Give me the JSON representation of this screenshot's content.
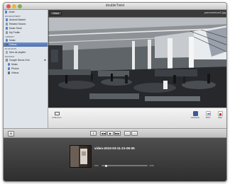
{
  "window": {
    "title": "doubleTwist"
  },
  "sidebar": {
    "user": "Jorah",
    "sections": [
      {
        "header": "DOUBLETWIST",
        "items": [
          "Android Market",
          "Related Search",
          "Music Store",
          "My Profile"
        ]
      },
      {
        "header": "LIBRARY",
        "items": [
          "Music",
          "Videos"
        ]
      },
      {
        "header": "PLAYLISTS",
        "items": [
          "New de playlist"
        ]
      },
      {
        "header": "DEVICES",
        "items": [
          "Google Nexus One",
          "Music",
          "Photos",
          "Videos"
        ]
      }
    ]
  },
  "topbar": {
    "close_label": "Close",
    "filename": "panoramicos2.jpg"
  },
  "shelf": {
    "fullscreen_label": "Fullscreen",
    "share": [
      {
        "label": "Facebook",
        "icon": "facebook-icon"
      },
      {
        "label": "Flickr",
        "icon": "flickr-icon"
      },
      {
        "label": "Web",
        "icon": "youtube-icon"
      }
    ]
  },
  "controls": {
    "add_label": "+",
    "buttons": [
      "⇪",
      "◀◀",
      "▶",
      "▶▶",
      "▭",
      "▭"
    ]
  },
  "player": {
    "clip_name": "video-2010-03-11-21-06-05",
    "time_elapsed": "0:00",
    "time_remaining": "-0:06",
    "progress": 0.06
  }
}
